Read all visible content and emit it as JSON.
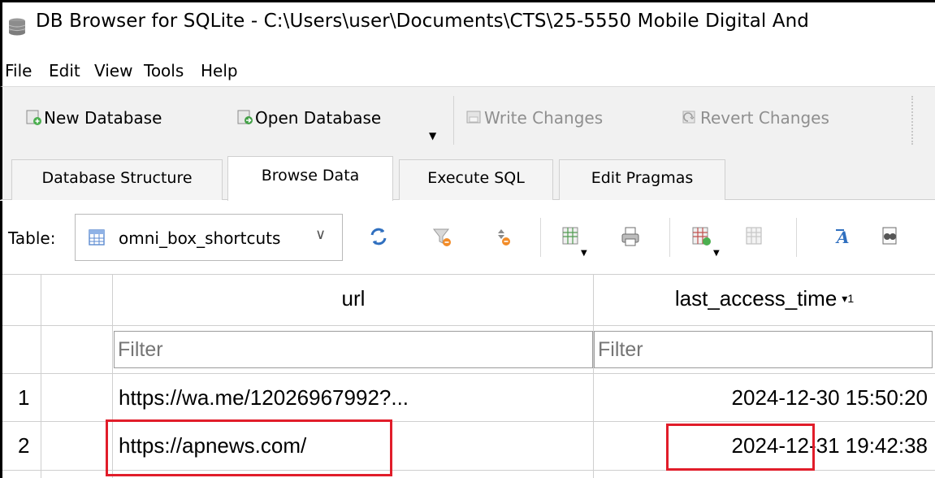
{
  "window": {
    "title": "DB Browser for SQLite - C:\\Users\\user\\Documents\\CTS\\25-5550 Mobile Digital And"
  },
  "menu": [
    "File",
    "Edit",
    "View",
    "Tools",
    "Help"
  ],
  "toolbar": {
    "new_db": "New Database",
    "open_db": "Open Database",
    "write_changes": "Write Changes",
    "revert_changes": "Revert Changes"
  },
  "tabs": [
    "Database Structure",
    "Browse Data",
    "Execute SQL",
    "Edit Pragmas"
  ],
  "active_tab": "Browse Data",
  "browse": {
    "table_label": "Table:",
    "table_name": "omni_box_shortcuts"
  },
  "grid": {
    "columns": [
      {
        "name": "url"
      },
      {
        "name": "last_access_time",
        "sort_indicator": "▾1"
      }
    ],
    "filter_placeholder": "Filter",
    "rows": [
      {
        "num": "1",
        "url": "https://wa.me/12026967992?...",
        "date": "2024-12-30",
        "time": "15:50:20"
      },
      {
        "num": "2",
        "url": "https://apnews.com/",
        "date": "2024-12-31",
        "time": "19:42:38"
      }
    ]
  },
  "colors": {
    "highlight": "#e11d2a",
    "disabled_text": "#8f8f8f"
  }
}
